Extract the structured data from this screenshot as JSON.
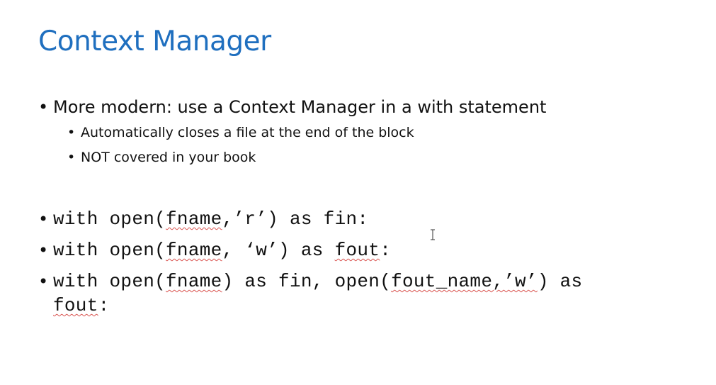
{
  "slide": {
    "title": "Context Manager",
    "bullets": [
      {
        "text": "More modern: use a Context Manager in a with statement",
        "sub": [
          "Automatically closes a file at the end of the block",
          "NOT covered in your book"
        ]
      }
    ],
    "code_lines": [
      {
        "parts": [
          "with open(",
          "fname",
          ",’r’) as fin:"
        ]
      },
      {
        "parts": [
          "with open(",
          "fname",
          ", ‘w’) as ",
          "fout",
          ":"
        ]
      },
      {
        "parts": [
          "with open(",
          "fname",
          ") as fin, open(",
          "fout_name,’w’",
          ") as"
        ],
        "continuation": [
          "fout",
          ":"
        ]
      }
    ],
    "bullet_glyph": "•"
  }
}
